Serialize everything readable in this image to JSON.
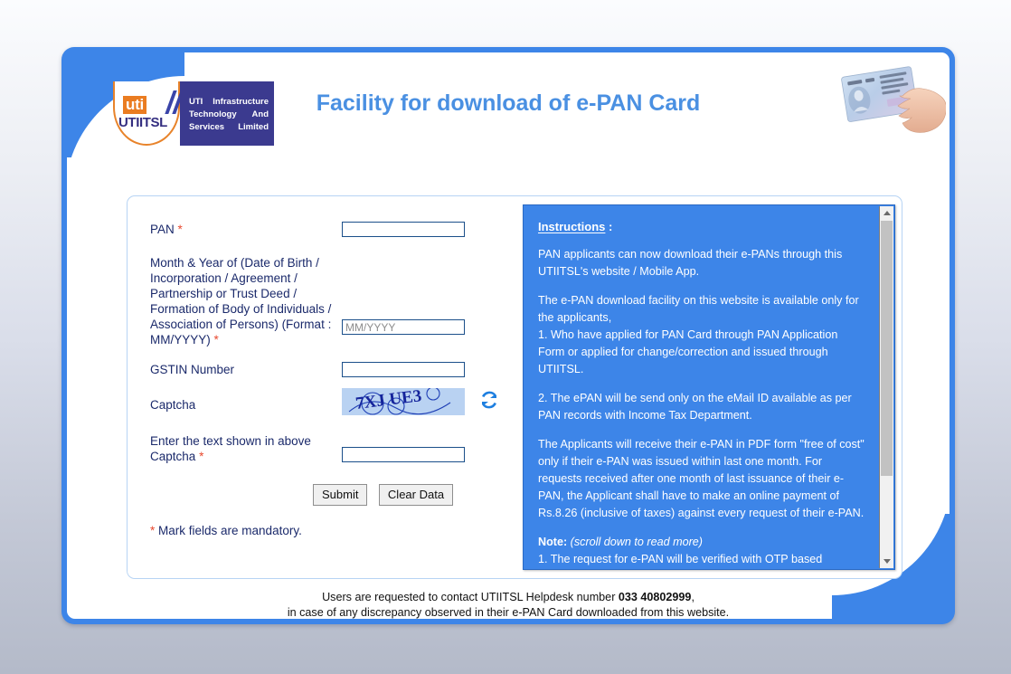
{
  "header": {
    "title": "Facility for download of e-PAN Card",
    "logo": {
      "uti_mark": "uti",
      "utiitsl_mark": "UTIITSL",
      "line1_left": "UTI",
      "line1_right": "Infrastructure",
      "line2_left": "Technology",
      "line2_right": "And",
      "line3_left": "Services",
      "line3_right": "Limited"
    }
  },
  "form": {
    "pan_label": "PAN",
    "pan_value": "",
    "month_label": "Month & Year of (Date of Birth / Incorporation / Agreement / Partnership or Trust Deed / Formation of Body of Individuals / Association of Persons) (Format : MM/YYYY)",
    "month_placeholder": "MM/YYYY",
    "month_value": "",
    "gstin_label": "GSTIN Number",
    "gstin_value": "",
    "captcha_label": "Captcha",
    "captcha_text": "7XJ UE3",
    "enter_captcha_label": "Enter the text shown in above Captcha",
    "enter_captcha_value": "",
    "submit_label": "Submit",
    "clear_label": "Clear Data",
    "mandatory_note_mark": "*",
    "mandatory_note": " Mark fields are mandatory.",
    "required_mark": "*"
  },
  "instructions": {
    "title": "Instructions",
    "title_colon": " :",
    "p1": "PAN applicants can now download their e-PANs through this UTIITSL's website / Mobile App.",
    "p2": "The e-PAN download facility on this website is available only for the applicants,",
    "p3": "1. Who have applied for PAN Card through PAN Application Form or applied for change/correction and issued through UTIITSL.",
    "p4": "2. The ePAN will be send only on the eMail ID available as per PAN records with Income Tax Department.",
    "p5": "The Applicants will receive their e-PAN in PDF form \"free of cost\" only if their e-PAN was issued within last one month. For requests received after one month of last issuance of their e-PAN, the Applicant shall have to make an online payment of Rs.8.26 (inclusive of taxes) against every request of their e-PAN.",
    "note_label": "Note:",
    "note_scroll": " (scroll down to read more)",
    "note_1": "1. The request for e-PAN will be verified with OTP based"
  },
  "footer": {
    "line1_pre": "Users are requested to contact UTIITSL Helpdesk number ",
    "line1_phone": "033 40802999",
    "line1_post": ",",
    "line2": "in case of any discrepancy observed in their e-PAN Card downloaded from this website."
  },
  "colors": {
    "brand_blue": "#3d85e8",
    "title_blue": "#4a90e2",
    "label_navy": "#1b2a6b",
    "required_red": "#e8492f",
    "logo_orange": "#ea7c21",
    "logo_navy": "#3b3a8f"
  }
}
